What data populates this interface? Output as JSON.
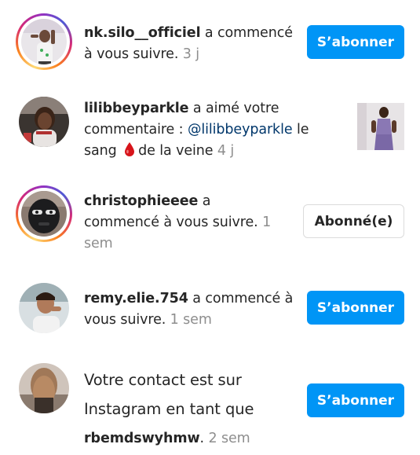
{
  "notifications": [
    {
      "username": "nk.silo__officiel",
      "text": " a commencé à vous suivre. ",
      "time": "3 j",
      "action_label": "S’abonner",
      "has_story_ring": true
    },
    {
      "username": "lilibbeyparkle",
      "text_before": " a aimé votre commentaire : ",
      "mention": "@lilibbeyparkle",
      "text_after_1": " le sang ",
      "text_after_2": "de la veine ",
      "time": "4 j",
      "emoji_icon": "blood-drop-icon",
      "has_story_ring": false
    },
    {
      "username": "christophieeee",
      "text": " a commencé à vous suivre. ",
      "time": "1 sem",
      "action_label": "Abonné(e)",
      "has_story_ring": true
    },
    {
      "username": "remy.elie.754",
      "text": " a commencé à vous suivre. ",
      "time": "1 sem",
      "action_label": "S’abonner",
      "has_story_ring": false
    },
    {
      "text_before": "Votre contact est sur Instagram en tant que ",
      "username": "rbemdswyhmw",
      "text_after": ". ",
      "time": "2 sem",
      "action_label": "S’abonner",
      "has_story_ring": false
    }
  ],
  "colors": {
    "primary_button": "#0095f6",
    "username": "#262626",
    "timestamp": "#8e8e8e",
    "mention": "#00376b"
  }
}
